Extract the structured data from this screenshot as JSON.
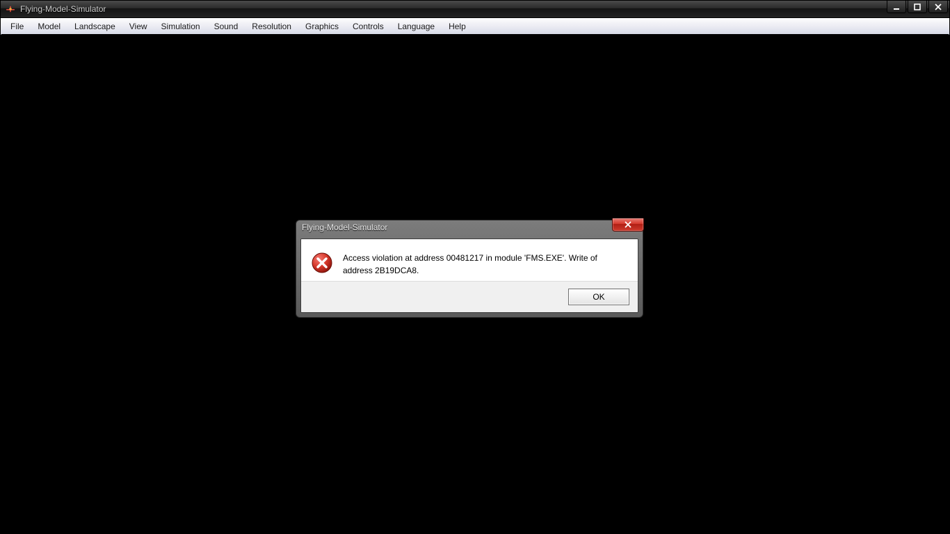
{
  "app": {
    "title": "Flying-Model-Simulator"
  },
  "menu": {
    "items": [
      "File",
      "Model",
      "Landscape",
      "View",
      "Simulation",
      "Sound",
      "Resolution",
      "Graphics",
      "Controls",
      "Language",
      "Help"
    ]
  },
  "dialog": {
    "title": "Flying-Model-Simulator",
    "message": "Access violation at address 00481217 in module 'FMS.EXE'. Write of address 2B19DCA8.",
    "ok_label": "OK"
  }
}
